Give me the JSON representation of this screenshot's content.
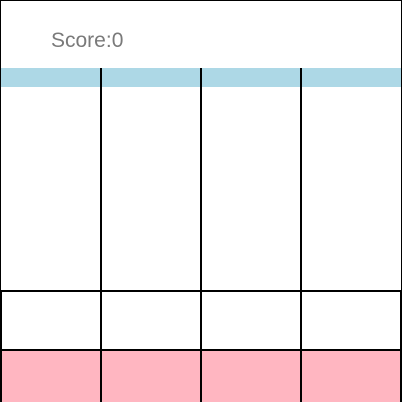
{
  "header": {
    "score_label": "Score:",
    "score_value": "0"
  },
  "board": {
    "lanes": 4,
    "colors": {
      "top_strip": "#add8e6",
      "start_row": "#ffffff",
      "target_row": "#ffb6c1",
      "score_text": "#7a7a7a",
      "grid_lines": "#000000"
    }
  }
}
